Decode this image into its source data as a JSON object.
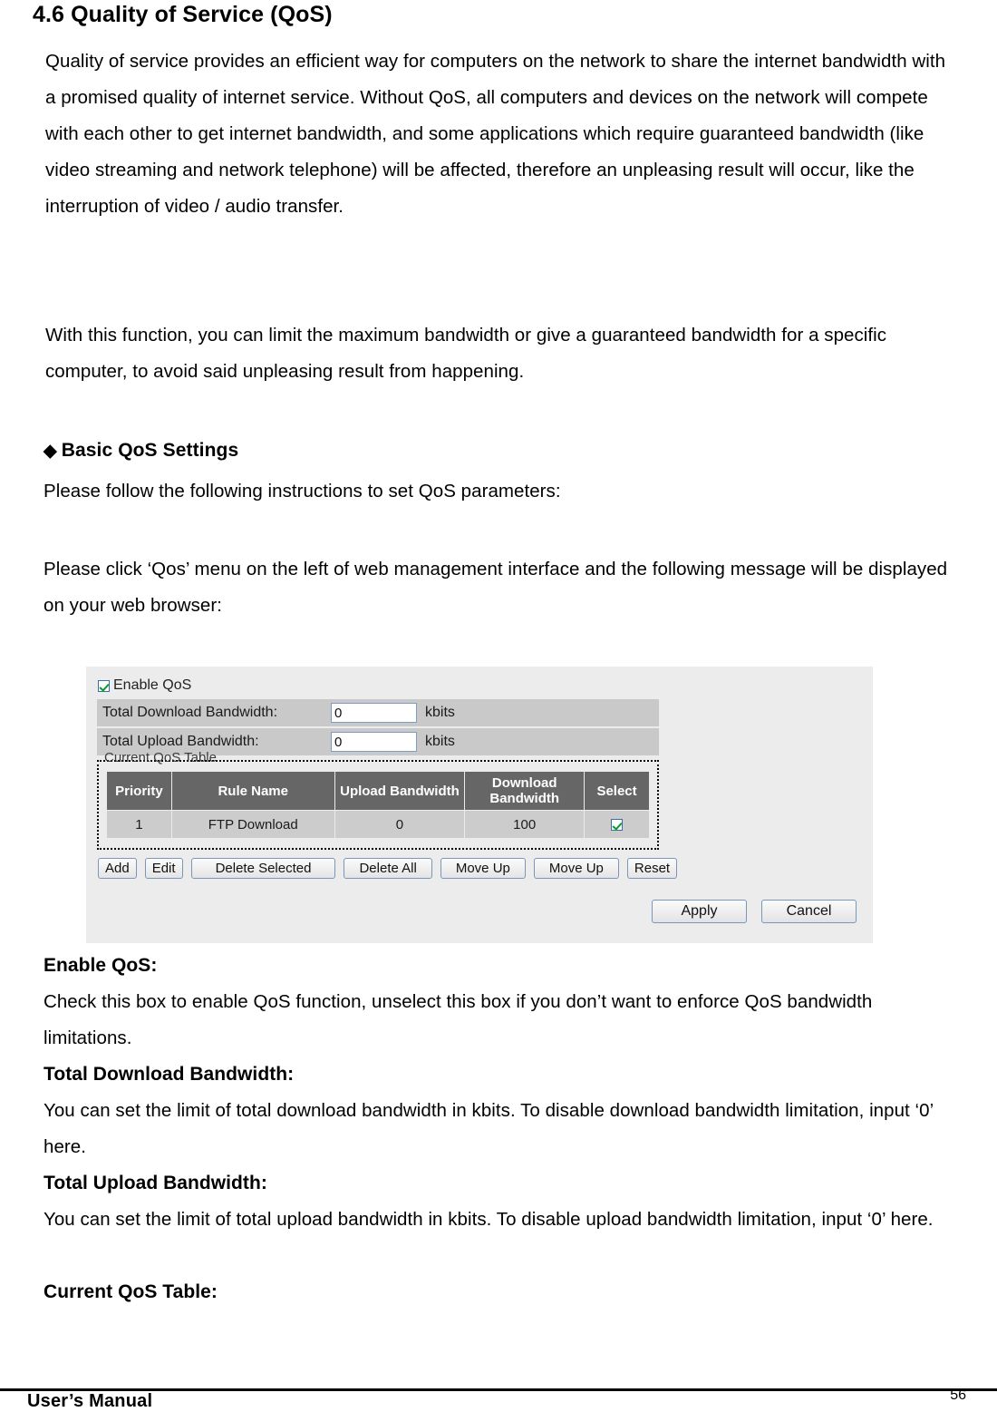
{
  "document": {
    "section_number_title": "4.6 Quality of Service (QoS)",
    "paragraph_1": "Quality of service provides an efficient way for computers on the network to share the internet bandwidth with a promised quality of internet service. Without QoS, all computers and devices on the network will compete with each other to get internet bandwidth, and some applications which require guaranteed bandwidth (like video streaming and network telephone) will be affected, therefore an unpleasing result will occur, like the interruption of video / audio transfer.",
    "paragraph_2": "With this function, you can limit the maximum bandwidth or give a guaranteed bandwidth for a specific computer, to avoid said unpleasing result from happening.",
    "subheading_bullet": "◆",
    "subheading": "Basic QoS Settings",
    "paragraph_3": "Please follow the following instructions to set QoS parameters:",
    "paragraph_4": "Please click ‘Qos’ menu on the left of web management interface and the following message will be displayed on your web browser:",
    "terms": [
      {
        "term": "Enable QoS:",
        "description": "Check this box to enable QoS function, unselect this box if you don’t want to enforce QoS bandwidth limitations."
      },
      {
        "term": "Total Download Bandwidth:",
        "description": "You can set the limit of total download bandwidth in kbits. To disable download bandwidth limitation, input ‘0’ here."
      },
      {
        "term": "Total Upload Bandwidth:",
        "description": "You can set the limit of total upload bandwidth in kbits. To disable upload bandwidth limitation, input ‘0’ here."
      },
      {
        "term": "Current QoS Table:",
        "description": ""
      }
    ]
  },
  "footer": {
    "left_text": "User’s Manual",
    "page_number": "56"
  },
  "ui_screenshot": {
    "enable_qos": {
      "label": "Enable QoS",
      "checked": true
    },
    "fields": [
      {
        "label": "Total Download Bandwidth:",
        "value": "0",
        "unit": "kbits"
      },
      {
        "label": "Total Upload Bandwidth:",
        "value": "0",
        "unit": "kbits"
      }
    ],
    "table_section": {
      "legend": "Current QoS Table",
      "columns": [
        "Priority",
        "Rule Name",
        "Upload Bandwidth",
        "Download Bandwidth",
        "Select"
      ],
      "rows": [
        {
          "priority": "1",
          "rule_name": "FTP Download",
          "upload_bandwidth": "0",
          "download_bandwidth": "100",
          "selected": true
        }
      ]
    },
    "table_buttons": [
      "Add",
      "Edit",
      "Delete Selected",
      "Delete All",
      "Move Up",
      "Move Up",
      "Reset"
    ],
    "form_buttons": [
      "Apply",
      "Cancel"
    ],
    "colors": {
      "panel_background": "#ececec",
      "field_row_background": "#c9c9c9",
      "table_header_background": "#666666",
      "table_row_background": "#cccccc",
      "checkbox_border": "#3a6ea5",
      "checkbox_check": "#0a9a28",
      "button_border": "#7a96ba"
    }
  }
}
